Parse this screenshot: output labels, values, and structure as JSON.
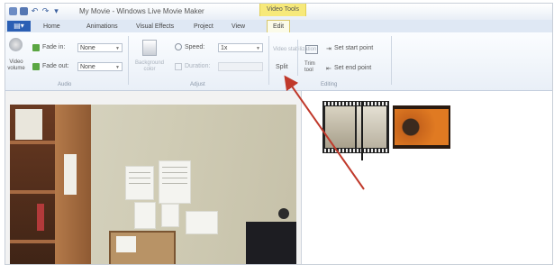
{
  "window": {
    "title": "My Movie - Windows Live Movie Maker",
    "context_tab_header": "Video Tools"
  },
  "tabs": {
    "file_tab": "▤▾",
    "items": [
      "Home",
      "Animations",
      "Visual Effects",
      "Project",
      "View",
      "Edit"
    ],
    "active": "Edit"
  },
  "ribbon": {
    "audio": {
      "video_volume_label": "Video volume",
      "fade_in_label": "Fade in:",
      "fade_in_value": "None",
      "fade_out_label": "Fade out:",
      "fade_out_value": "None",
      "group_label": "Audio"
    },
    "adjust": {
      "background_color_label": "Background color",
      "speed_label": "Speed:",
      "speed_value": "1x",
      "duration_label": "Duration:",
      "duration_value": "",
      "group_label": "Adjust"
    },
    "editing": {
      "video_stabilization_label": "Video stabilization",
      "split_label": "Split",
      "trim_tool_label": "Trim tool",
      "set_start_point_label": "Set start point",
      "set_end_point_label": "Set end point",
      "group_label": "Editing"
    }
  },
  "colors": {
    "annotation_arrow": "#c0392b",
    "file_tab": "#2b5fb4",
    "context_tab": "#f7e97a"
  }
}
